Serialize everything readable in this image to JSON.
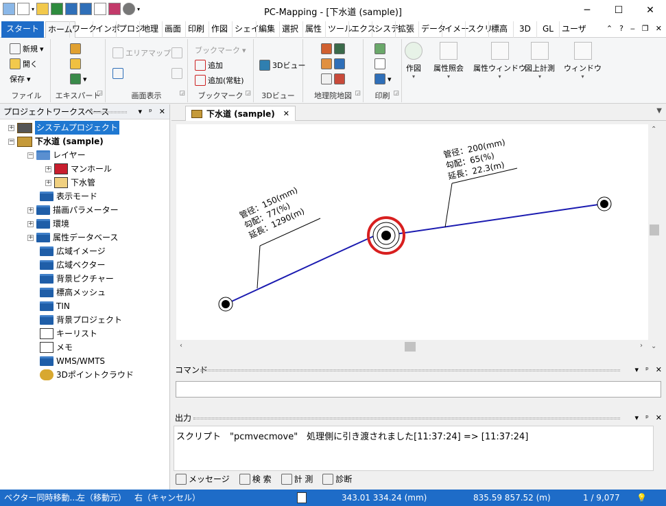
{
  "window": {
    "title": "PC-Mapping - [下水道 (sample)]",
    "minimize": "─",
    "maximize": "☐",
    "close": "✕"
  },
  "ribbon_tabs": [
    "スタート",
    "ホーム",
    "ワーク",
    "インポ",
    "プロジ",
    "地理",
    "画面",
    "印刷",
    "作図",
    "シェイ",
    "編集",
    "選択",
    "属性",
    "ツール",
    "エクス",
    "システ",
    "拡張",
    "データ",
    "イメー",
    "スクリ",
    "標高",
    "3D",
    "GL",
    "ユーザ"
  ],
  "ribbon": {
    "file": {
      "new": "新規",
      "open": "開く",
      "save": "保存",
      "label": "ファイル"
    },
    "export": {
      "label": "エキスパート"
    },
    "display": {
      "areamap": "エリアマップ",
      "label": "画面表示"
    },
    "bookmark": {
      "bookmark": "ブックマーク",
      "add": "追加",
      "add_fixed": "追加(常駐)",
      "label": "ブックマーク"
    },
    "view3d": {
      "btn": "3Dビュー",
      "label": "3Dビュー"
    },
    "gsi": {
      "label": "地理院地図"
    },
    "print": {
      "label": "印刷"
    },
    "big_buttons": [
      "作図",
      "属性照会",
      "属性ウィンドウ",
      "図上計測",
      "ウィンドウ"
    ]
  },
  "workspace": {
    "title": "プロジェクトワークスペース",
    "pin": "ᵖ",
    "close": "✕",
    "tree": {
      "system_project": "システムプロジェクト",
      "project": "下水道 (sample)",
      "layers": "レイヤー",
      "manhole": "マンホール",
      "pipe": "下水管",
      "folders": [
        "表示モード",
        "描画パラメーター",
        "環境",
        "属性データベース",
        "広域イメージ",
        "広域ベクター",
        "背景ピクチャー",
        "標高メッシュ",
        "TIN",
        "背景プロジェクト",
        "キーリスト",
        "メモ",
        "WMS/WMTS",
        "3Dポイントクラウド"
      ]
    }
  },
  "document": {
    "tab_label": "下水道 (sample)",
    "tab_close": "✕"
  },
  "map": {
    "label_left": [
      "管径：150(mm)",
      "勾配：77(%)",
      "延長：1290(m)"
    ],
    "label_right": [
      "管径：200(mm)",
      "勾配：65(%)",
      "延長：22.3(m)"
    ],
    "line_color": "#1a1ab0",
    "highlight_color": "#d81f1f"
  },
  "command_panel": {
    "title": "コマンド"
  },
  "output_panel": {
    "title": "出力",
    "message": "スクリプト　\"pcmvecmove\"　処理側に引き渡されました[11:37:24] => [11:37:24]",
    "tabs": [
      "メッセージ",
      "検 索",
      "計 測",
      "診断"
    ]
  },
  "statusbar": {
    "mode": "ベクター同時移動...",
    "left_click": "左（移動元）",
    "right_click": "右（キャンセル）",
    "coords_mm": "343.01 334.24 (mm)",
    "coords_world": "835.59 857.52 (m)",
    "scale": "1 / 9,077"
  },
  "colors": {
    "accent": "#1e6cc8",
    "selection": "#1f78d1"
  }
}
